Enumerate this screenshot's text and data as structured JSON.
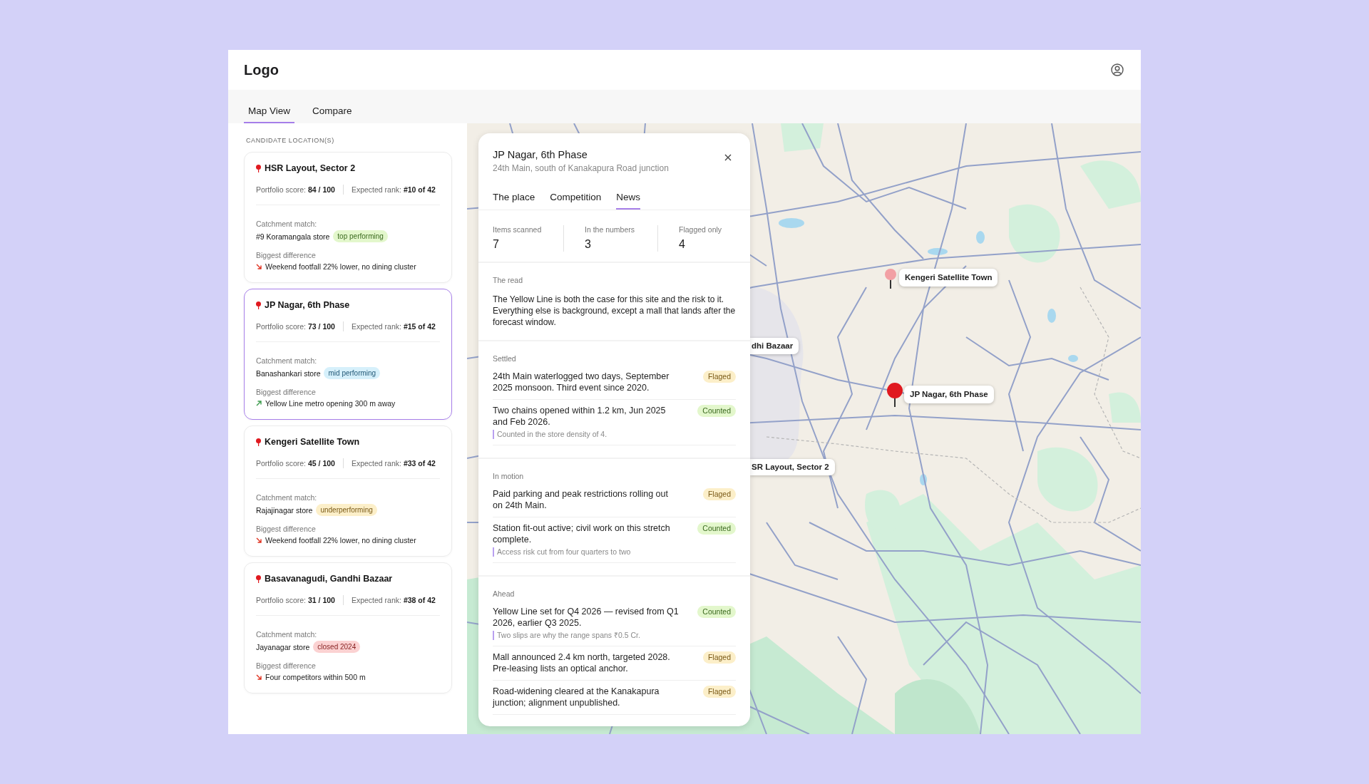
{
  "header": {
    "logo": "Logo"
  },
  "tabs": [
    {
      "label": "Map View",
      "selected": true
    },
    {
      "label": "Compare",
      "selected": false
    }
  ],
  "sidebar": {
    "heading": "CANDIDATE LOCATION(S)",
    "cards": [
      {
        "title": "HSR Layout, Sector 2",
        "selected": false,
        "score": "Portfolio score: **84 / 100**",
        "rank": "Expected rank: **#10 of 42**",
        "match_label": "Catchment match:",
        "store": "#9 Koramangala store",
        "badge": {
          "text": "top performing",
          "kind": "top"
        },
        "difference_label": "Biggest difference",
        "difference": {
          "text": "Weekend footfall 22% lower, no dining cluster",
          "kind": "down"
        }
      },
      {
        "title": "JP Nagar, 6th Phase",
        "selected": true,
        "score": "Portfolio score: **73 / 100**",
        "rank": "Expected rank: **#15 of 42**",
        "match_label": "Catchment match:",
        "store": "Banashankari store",
        "badge": {
          "text": "mid performing",
          "kind": "mid"
        },
        "difference_label": "Biggest difference",
        "difference": {
          "text": "Yellow Line metro opening 300 m away",
          "kind": "up"
        }
      },
      {
        "title": "Kengeri Satellite Town",
        "selected": false,
        "score": "Portfolio score: **45 / 100**",
        "rank": "Expected rank: **#33 of 42**",
        "match_label": "Catchment match:",
        "store": "Rajajinagar store",
        "badge": {
          "text": "underperforming",
          "kind": "under"
        },
        "difference_label": "Biggest difference",
        "difference": {
          "text": "Weekend footfall 22% lower, no dining cluster",
          "kind": "down"
        }
      },
      {
        "title": "Basavanagudi, Gandhi Bazaar",
        "selected": false,
        "score": "Portfolio score: **31 / 100**",
        "rank": "Expected rank: **#38 of 42**",
        "match_label": "Catchment match:",
        "store": "Jayanagar store",
        "badge": {
          "text": "closed 2024",
          "kind": "closed"
        },
        "difference_label": "Biggest difference",
        "difference": {
          "text": "Four competitors within 500 m",
          "kind": "down"
        }
      }
    ]
  },
  "map": {
    "pins": [
      {
        "label": "Kengeri Satellite Town",
        "selected": false
      },
      {
        "label": "JP Nagar, 6th Phase",
        "selected": true
      }
    ],
    "clipped_labels": [
      "dhi Bazaar",
      "SR Layout, Sector 2"
    ]
  },
  "detail": {
    "title": "JP Nagar, 6th Phase",
    "subtitle": "24th Main, south of Kanakapura Road junction",
    "tabs": [
      {
        "label": "The place",
        "selected": false
      },
      {
        "label": "Competition",
        "selected": false
      },
      {
        "label": "News",
        "selected": true
      }
    ],
    "stats": [
      {
        "label": "Items scanned",
        "value": "7"
      },
      {
        "label": "In the numbers",
        "value": "3"
      },
      {
        "label": "Flagged only",
        "value": "4"
      }
    ],
    "summary": {
      "heading": "The read",
      "text": "The Yellow Line is both the case for this site and the risk to it. Everything else is background, except a mall that lands after the forecast window."
    },
    "sections": [
      {
        "heading": "Settled",
        "items": [
          {
            "text": "24th Main waterlogged two days, September 2025 monsoon. Third event since 2020.",
            "tag": {
              "text": "Flaged",
              "kind": "flagged"
            }
          },
          {
            "text": "Two chains opened within 1.2 km, Jun 2025 and Feb 2026.",
            "tag": {
              "text": "Counted",
              "kind": "counted"
            },
            "note": "Counted in the store density of 4."
          }
        ]
      },
      {
        "heading": "In motion",
        "items": [
          {
            "text": "Paid parking and peak restrictions rolling out on 24th Main.",
            "tag": {
              "text": "Flaged",
              "kind": "flagged"
            }
          },
          {
            "text": "Station fit-out active; civil work on this stretch complete.",
            "tag": {
              "text": "Counted",
              "kind": "counted"
            },
            "note": "Access risk cut from four quarters to two"
          }
        ]
      },
      {
        "heading": "Ahead",
        "items": [
          {
            "text": "Yellow Line set for Q4 2026 — revised from Q1 2026, earlier Q3 2025.",
            "tag": {
              "text": "Counted",
              "kind": "counted"
            },
            "note": "Two slips are why the range spans ₹0.5 Cr."
          },
          {
            "text": "Mall announced 2.4 km north, targeted 2028. Pre-leasing lists an optical anchor.",
            "tag": {
              "text": "Flaged",
              "kind": "flagged"
            }
          },
          {
            "text": "Road-widening cleared at the Kanakapura junction; alignment unpublished.",
            "tag": {
              "text": "Flaged",
              "kind": "flagged"
            }
          }
        ]
      }
    ]
  }
}
